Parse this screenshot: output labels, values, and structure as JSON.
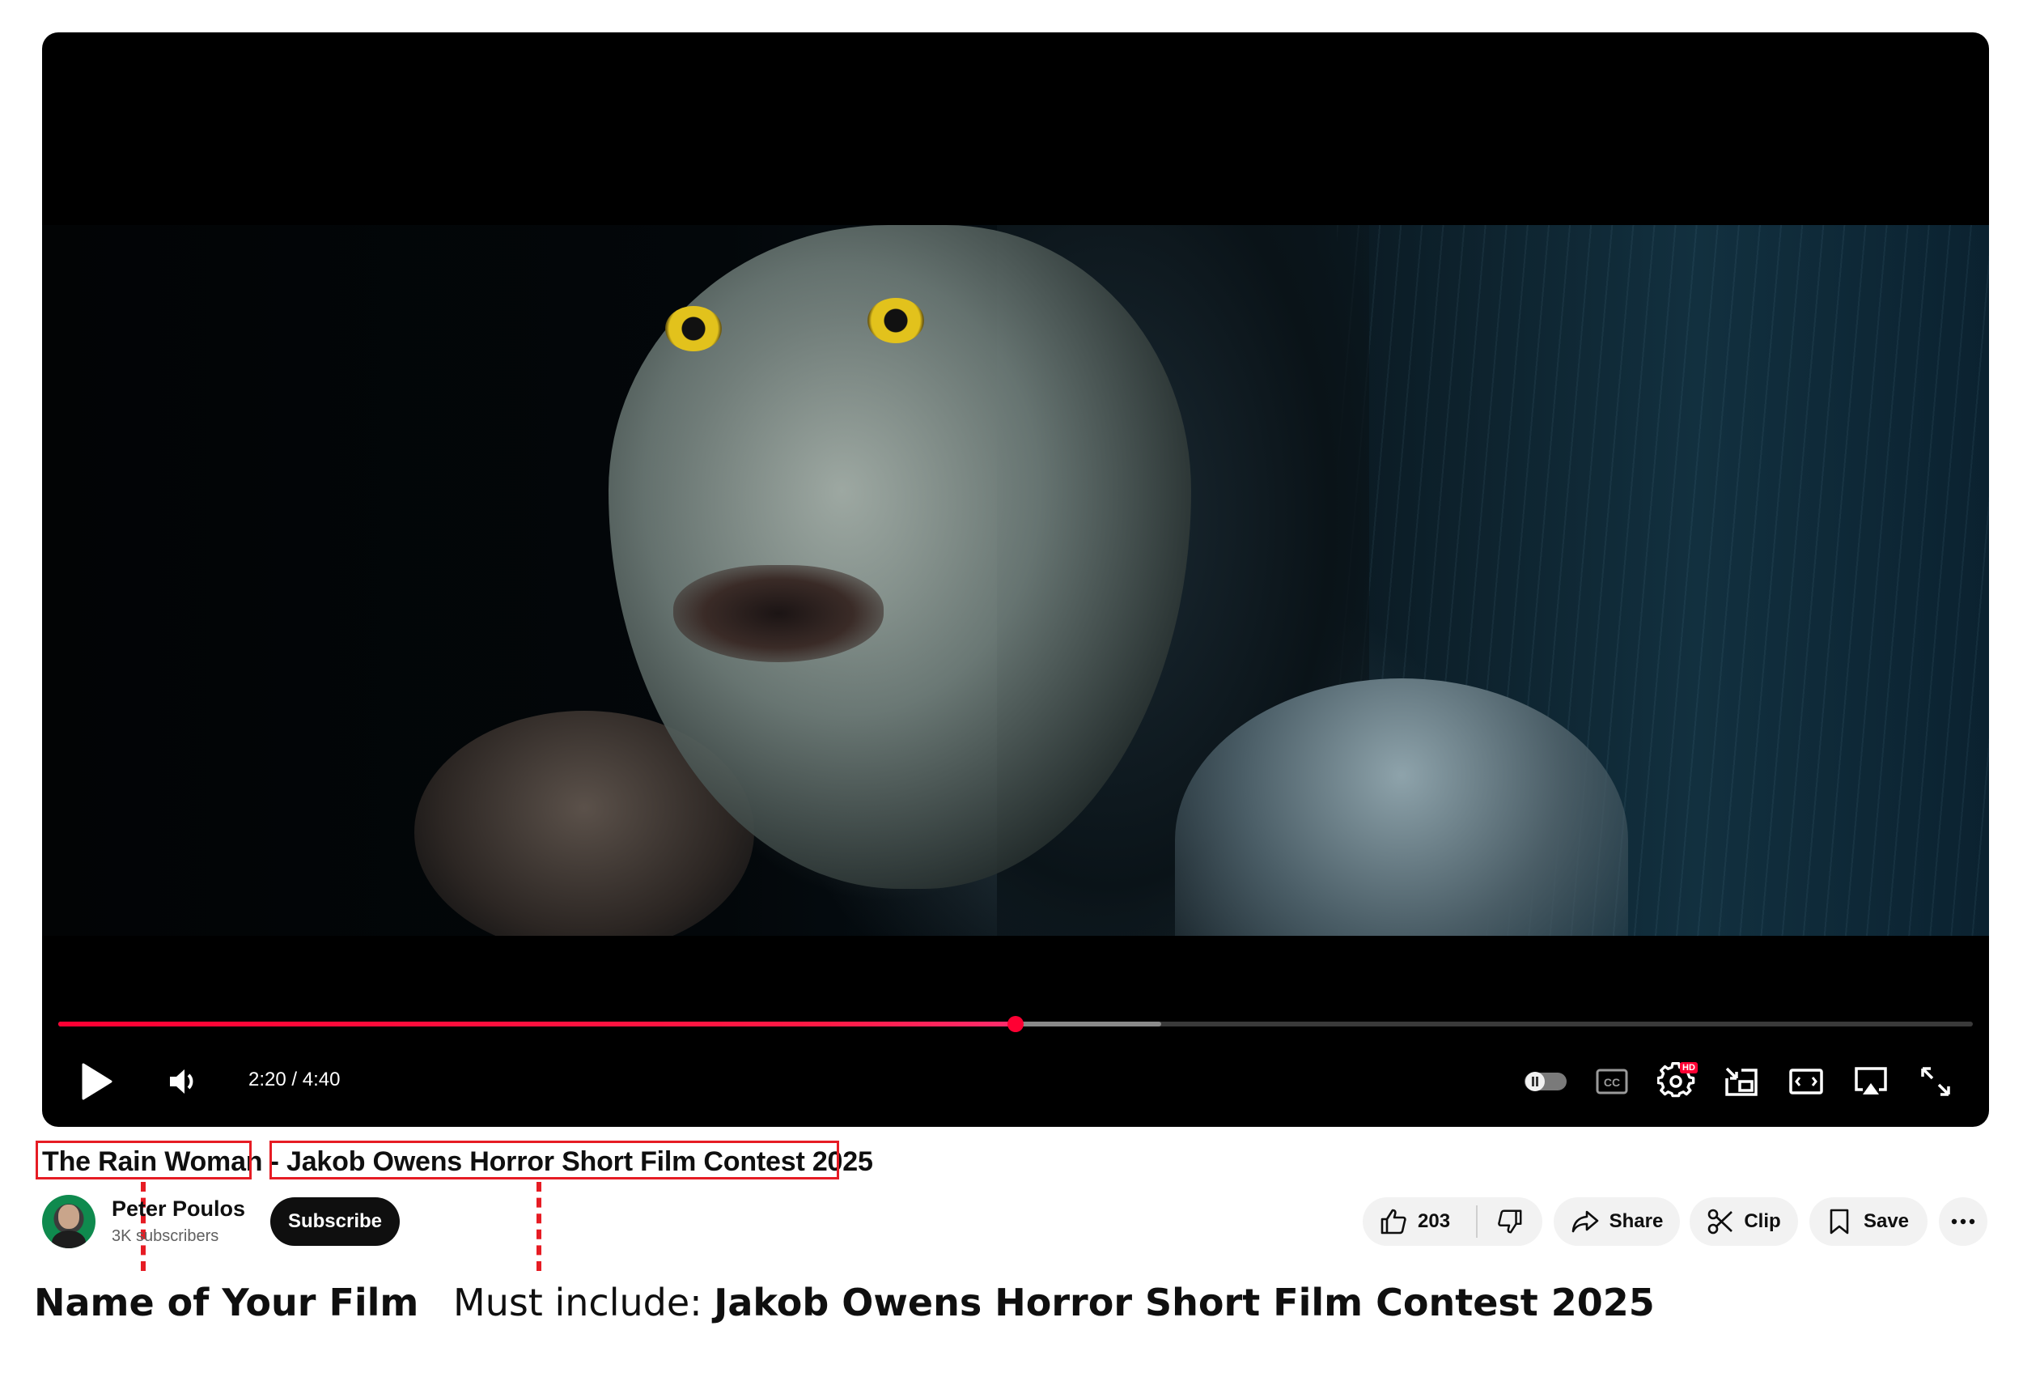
{
  "player": {
    "current_time": "2:20",
    "duration": "4:40",
    "time_separator": " / ",
    "progress_fraction": 0.5,
    "buffered_fraction": 0.576,
    "hd_badge": "HD",
    "accent_color": "#ff0033"
  },
  "video": {
    "title_name": "The Rain Woman",
    "title_separator": " - ",
    "title_contest": "Jakob Owens Horror Short Film Contest 2025"
  },
  "channel": {
    "name": "Peter Poulos",
    "subscribers": "3K subscribers",
    "subscribe_label": "Subscribe"
  },
  "actions": {
    "like_count": "203",
    "share_label": "Share",
    "clip_label": "Clip",
    "save_label": "Save"
  },
  "annotations": {
    "name_label": "Name of Your Film",
    "must_prefix": "Must include: ",
    "must_value": "Jakob Owens Horror Short Film Contest 2025",
    "highlight_color": "#e61c24"
  },
  "icons": {
    "play": "play-icon",
    "volume": "volume-icon",
    "autoplay": "autoplay-toggle-icon",
    "captions": "captions-icon",
    "settings": "settings-gear-icon",
    "miniplayer": "miniplayer-icon",
    "theater": "theater-mode-icon",
    "cast": "airplay-icon",
    "fullscreen": "fullscreen-icon",
    "like": "thumbs-up-icon",
    "dislike": "thumbs-down-icon",
    "share": "share-arrow-icon",
    "clip": "scissors-icon",
    "save": "bookmark-icon",
    "more": "more-horizontal-icon"
  }
}
